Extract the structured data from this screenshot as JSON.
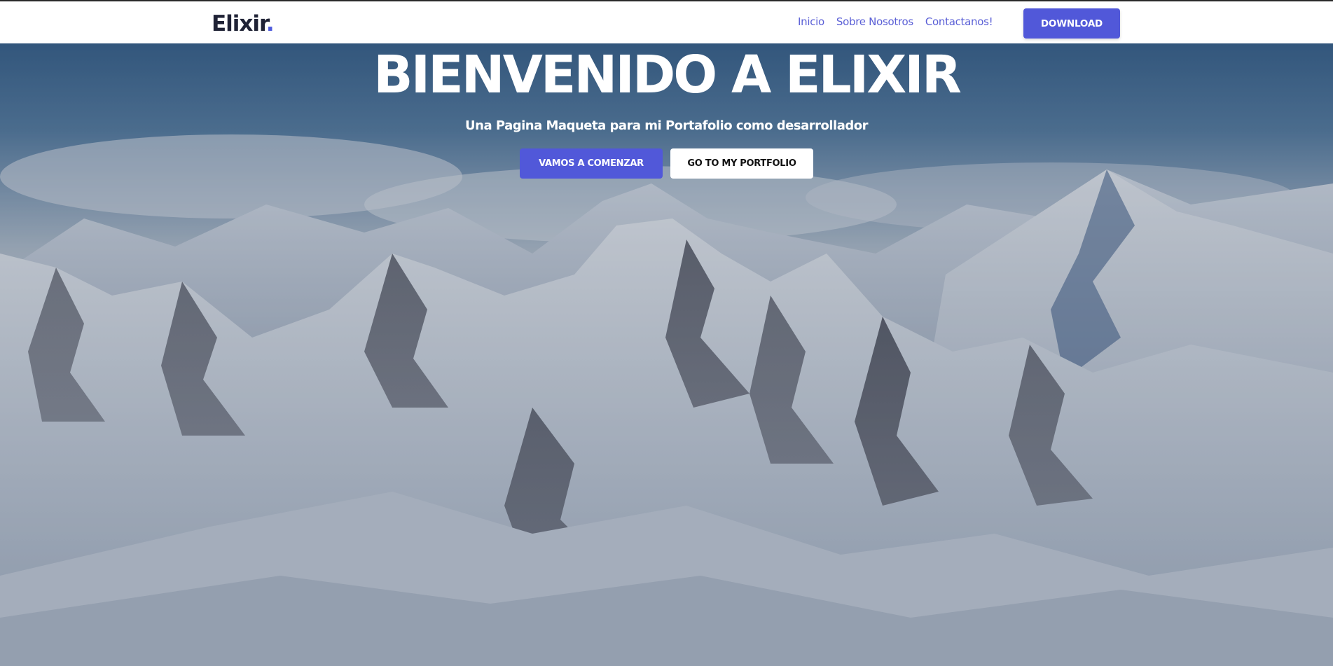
{
  "navbar": {
    "brand": "Elixir",
    "brand_dot": ".",
    "links": [
      "Inicio",
      "Sobre Nosotros",
      "Contactanos!"
    ],
    "download_label": "DOWNLOAD"
  },
  "hero": {
    "title": "BIENVENIDO A ELIXIR",
    "subtitle": "Una Pagina Maqueta para mi Portafolio como desarrollador",
    "primary_button": "VAMOS A COMENZAR",
    "secondary_button": "GO TO MY PORTFOLIO"
  },
  "colors": {
    "accent": "#5158d9",
    "link": "#5a5fd6",
    "brand_text": "#1f2235"
  }
}
